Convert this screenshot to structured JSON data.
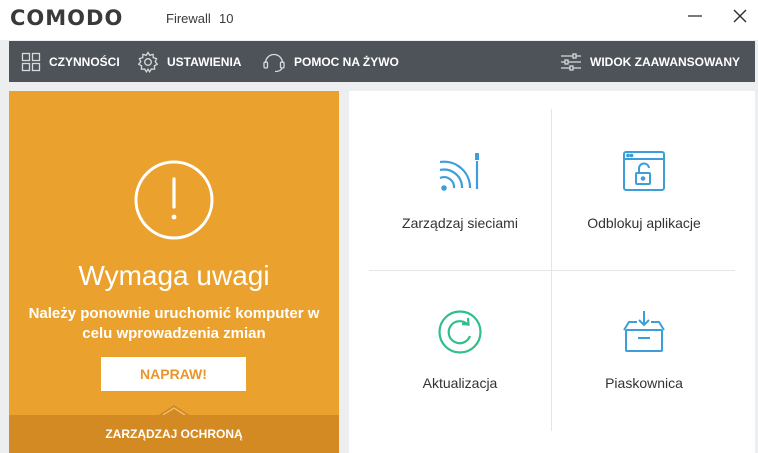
{
  "titlebar": {
    "logo": "COMODO",
    "product": "Firewall",
    "version": "10",
    "icons": {
      "minimize": "minimize-icon",
      "close": "close-icon"
    }
  },
  "navbar": {
    "actions_label": "CZYNNOŚCI",
    "settings_label": "USTAWIENIA",
    "help_label": "POMOC NA ŻYWO",
    "advanced_label": "WIDOK ZAAWANSOWANY",
    "icons": {
      "actions": "grid-icon",
      "settings": "gear-icon",
      "help": "headset-icon",
      "advanced": "sliders-icon"
    }
  },
  "status": {
    "icon": "exclamation-circle-icon",
    "title": "Wymaga uwagi",
    "description": "Należy ponownie uruchomić komputer w celu wprowadzenia zmian",
    "fix_label": "NAPRAW!",
    "manage_label": "ZARZĄDZAJ OCHRONĄ",
    "background_color": "#eba12d"
  },
  "tiles": [
    {
      "label": "Zarządzaj sieciami",
      "icon": "wifi-network-icon",
      "color": "#3d9fd9"
    },
    {
      "label": "Odblokuj aplikacje",
      "icon": "unlock-window-icon",
      "color": "#3d9fd9"
    },
    {
      "label": "Aktualizacja",
      "icon": "update-refresh-icon",
      "color": "#2fbf8a"
    },
    {
      "label": "Piaskownica",
      "icon": "sandbox-box-icon",
      "color": "#3d9fd9"
    }
  ]
}
